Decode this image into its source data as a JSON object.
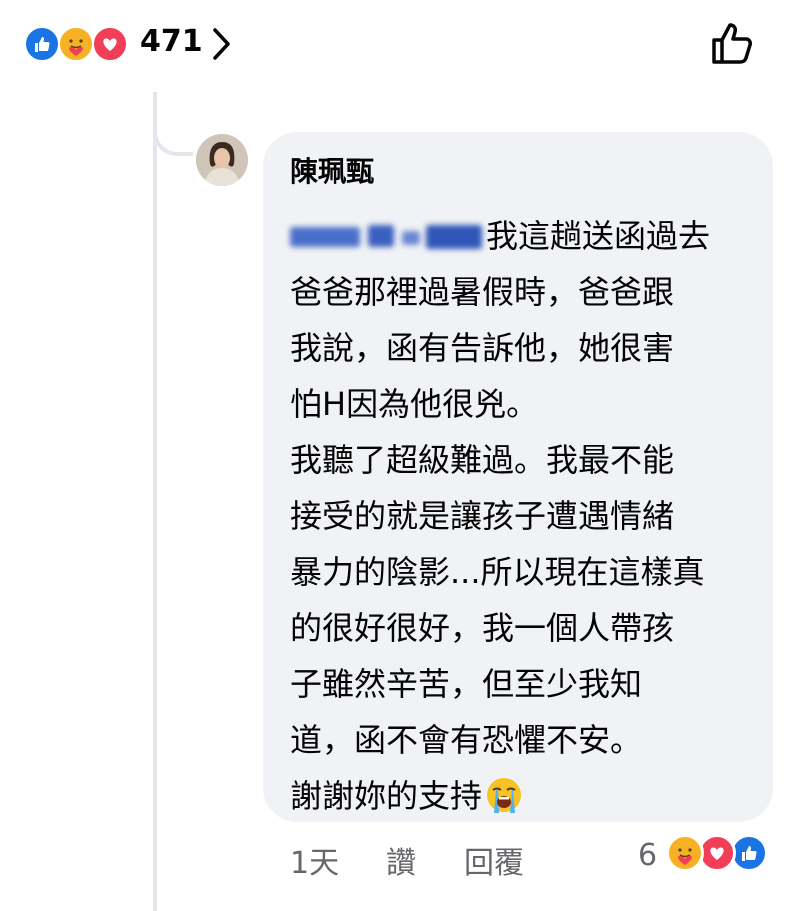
{
  "reactions_top": {
    "count": "471",
    "icons": [
      "like-reaction-icon",
      "care-reaction-icon",
      "love-reaction-icon"
    ]
  },
  "comment": {
    "author": "陳珮甄",
    "lines": [
      "我這趟送函過去",
      "爸爸那裡過暑假時，爸爸跟",
      "我說，函有告訴他，她很害",
      "怕H因為他很兇。",
      "我聽了超級難過。我最不能",
      "接受的就是讓孩子遭遇情緒",
      "暴力的陰影...所以現在這樣真",
      "的很好很好，我一個人帶孩",
      "子雖然辛苦，但至少我知",
      "道，函不會有恐懼不安。",
      "謝謝妳的支持"
    ],
    "redacted_mention": true,
    "trailing_emoji": "loudly-crying-face-emoji"
  },
  "actions": {
    "time": "1天",
    "like": "讚",
    "reply": "回覆"
  },
  "comment_reactions": {
    "count": "6",
    "icons": [
      "care-reaction-icon",
      "love-reaction-icon",
      "like-reaction-icon"
    ]
  },
  "colors": {
    "like_blue": "#1b74e4",
    "love_red": "#f33e58",
    "care_yellow": "#f7b125",
    "bubble_bg": "#f0f2f5",
    "meta_gray": "#65676b"
  }
}
